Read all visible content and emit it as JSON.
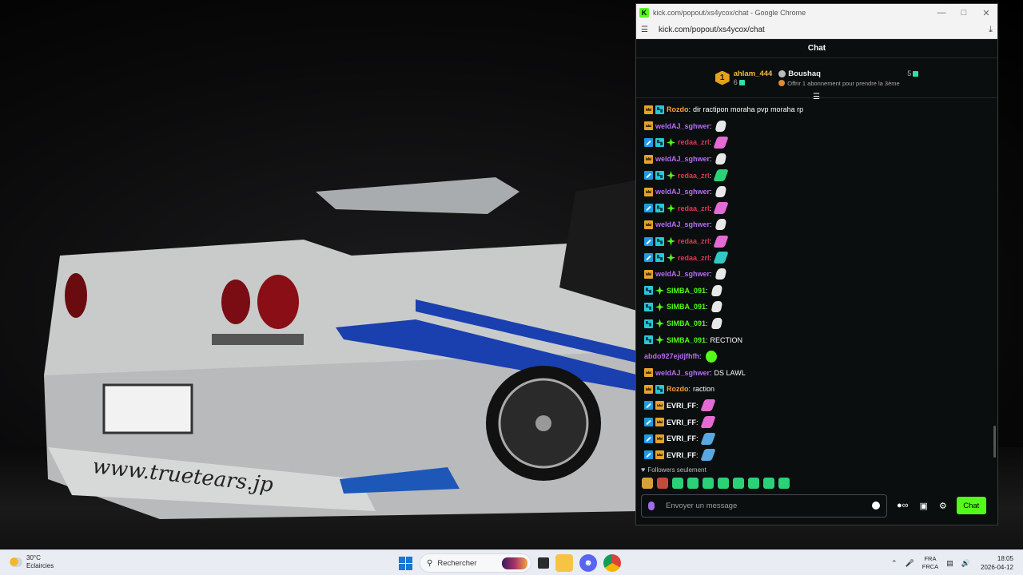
{
  "window": {
    "title": "kick.com/popout/xs4ycox/chat - Google Chrome",
    "url": "kick.com/popout/xs4ycox/chat"
  },
  "chat": {
    "title": "Chat",
    "pinned": {
      "top_gifter": {
        "rank": "1",
        "name": "ahlam_444",
        "count": "6"
      },
      "second_gifter": {
        "name": "Boushaq",
        "count": "5"
      },
      "cta": "Offrir 1 abonnement pour prendre la 3ème"
    },
    "messages": [
      {
        "badges": [
          "vip",
          "sub"
        ],
        "user": "Rozdo",
        "color": "#f8a23a",
        "text": "dir ractipon moraha pvp moraha rp",
        "emotes": []
      },
      {
        "badges": [
          "vip"
        ],
        "user": "weldAJ_sghwer",
        "color": "#b66cf2",
        "text": "",
        "emotes": [
          "white"
        ]
      },
      {
        "badges": [
          "mod",
          "sub",
          "og"
        ],
        "user": "redaa_zrl",
        "color": "#e0364d",
        "text": "",
        "emotes": [
          "pink"
        ]
      },
      {
        "badges": [
          "vip"
        ],
        "user": "weldAJ_sghwer",
        "color": "#b66cf2",
        "text": "",
        "emotes": [
          "white"
        ]
      },
      {
        "badges": [
          "mod",
          "sub",
          "og"
        ],
        "user": "redaa_zrl",
        "color": "#e0364d",
        "text": "",
        "emotes": [
          "green"
        ]
      },
      {
        "badges": [
          "vip"
        ],
        "user": "weldAJ_sghwer",
        "color": "#b66cf2",
        "text": "",
        "emotes": [
          "white"
        ]
      },
      {
        "badges": [
          "mod",
          "sub",
          "og"
        ],
        "user": "redaa_zrl",
        "color": "#e0364d",
        "text": "",
        "emotes": [
          "pink"
        ]
      },
      {
        "badges": [
          "vip"
        ],
        "user": "weldAJ_sghwer",
        "color": "#b66cf2",
        "text": "",
        "emotes": [
          "white"
        ]
      },
      {
        "badges": [
          "mod",
          "sub",
          "og"
        ],
        "user": "redaa_zrl",
        "color": "#e0364d",
        "text": "",
        "emotes": [
          "pink"
        ]
      },
      {
        "badges": [
          "mod",
          "sub",
          "og"
        ],
        "user": "redaa_zrl",
        "color": "#e0364d",
        "text": "",
        "emotes": [
          "teal"
        ]
      },
      {
        "badges": [
          "vip"
        ],
        "user": "weldAJ_sghwer",
        "color": "#b66cf2",
        "text": "",
        "emotes": [
          "white"
        ]
      },
      {
        "badges": [
          "sub",
          "og"
        ],
        "user": "SIMBA_091",
        "color": "#53fc18",
        "text": "",
        "emotes": [
          "white"
        ]
      },
      {
        "badges": [
          "sub",
          "og"
        ],
        "user": "SIMBA_091",
        "color": "#53fc18",
        "text": "",
        "emotes": [
          "white"
        ]
      },
      {
        "badges": [
          "sub",
          "og"
        ],
        "user": "SIMBA_091",
        "color": "#53fc18",
        "text": "",
        "emotes": [
          "white"
        ]
      },
      {
        "badges": [
          "sub",
          "og"
        ],
        "user": "SIMBA_091",
        "color": "#53fc18",
        "text": "RECTION",
        "emotes": []
      },
      {
        "badges": [],
        "user": "abdo927ejdjfhfh",
        "color": "#b66cf2",
        "text": "",
        "emotes": [
          "kick"
        ]
      },
      {
        "badges": [
          "vip"
        ],
        "user": "weldAJ_sghwer",
        "color": "#b66cf2",
        "text": "DS LAWL",
        "emotes": []
      },
      {
        "badges": [
          "vip",
          "sub"
        ],
        "user": "Rozdo",
        "color": "#f8a23a",
        "text": "raction",
        "emotes": []
      },
      {
        "badges": [
          "mod",
          "vip"
        ],
        "user": "EVRI_FF",
        "color": "#ffffff",
        "text": "",
        "emotes": [
          "pink"
        ]
      },
      {
        "badges": [
          "mod",
          "vip"
        ],
        "user": "EVRI_FF",
        "color": "#ffffff",
        "text": "",
        "emotes": [
          "pink"
        ]
      },
      {
        "badges": [
          "mod",
          "vip"
        ],
        "user": "EVRI_FF",
        "color": "#ffffff",
        "text": "",
        "emotes": [
          "blue"
        ]
      },
      {
        "badges": [
          "mod",
          "vip"
        ],
        "user": "EVRI_FF",
        "color": "#ffffff",
        "text": "",
        "emotes": [
          "blue"
        ]
      }
    ],
    "followers_only": "Followers seulement",
    "quick_emotes": [
      "#d6a13a",
      "#c44a3a",
      "#2ad176",
      "#2ad176",
      "#2ad176",
      "#2ad176",
      "#2ad176",
      "#2ad176",
      "#2ad176",
      "#2ad176"
    ],
    "input_placeholder": "Envoyer un message",
    "send_label": "Chat"
  },
  "taskbar": {
    "weather_temp": "30°C",
    "weather_desc": "Eclaircies",
    "search_label": "Rechercher",
    "lang_top": "FRA",
    "lang_bottom": "FRCA",
    "time": "18:05",
    "date": "2026-04-12"
  },
  "colors": {
    "kick_green": "#53fc18",
    "chat_bg": "#0b0e0f"
  }
}
